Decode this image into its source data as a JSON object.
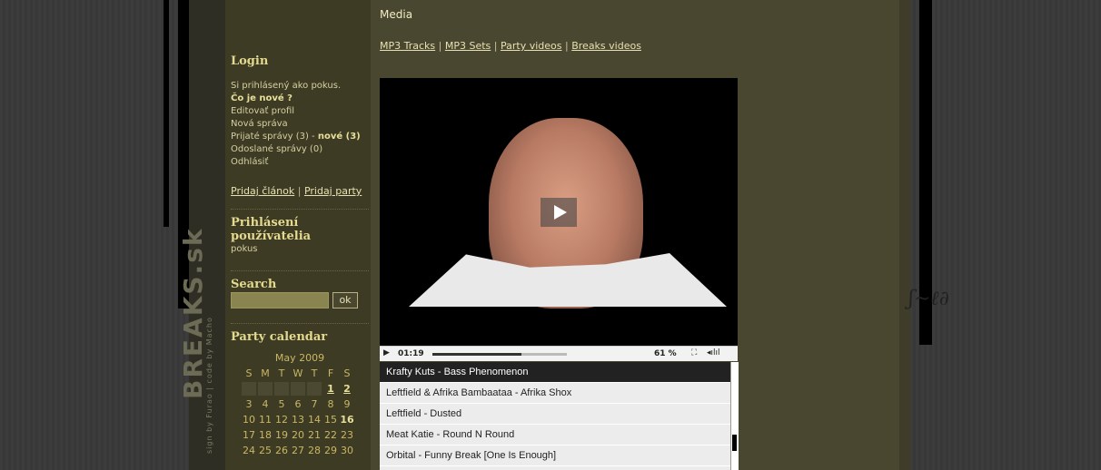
{
  "main": {
    "title": "Media",
    "nav": [
      "MP3 Tracks",
      "MP3 Sets",
      "Party videos",
      "Breaks videos"
    ],
    "nav_sep": "|"
  },
  "sidebar": {
    "login_title": "Login",
    "logged_as": "Si prihlásený ako pokus.",
    "whats_new": "Čo je nové ?",
    "edit_profile": "Editovať profil",
    "new_message": "Nová správa",
    "received": "Prijaté správy (3) -",
    "received_new": "nové (3)",
    "sent": "Odoslané správy (0)",
    "logout": "Odhlásiť",
    "add_article": "Pridaj článok",
    "add_party": "Pridaj party",
    "users_title_1": "Prihlásení",
    "users_title_2": "používatelia",
    "user": "pokus",
    "search_title": "Search",
    "search_button": "ok",
    "calendar_title": "Party calendar"
  },
  "calendar": {
    "month": "May 2009",
    "weekdays": [
      "S",
      "M",
      "T",
      "W",
      "T",
      "F",
      "S"
    ],
    "rows": [
      [
        "",
        "",
        "",
        "",
        "",
        "1",
        "2"
      ],
      [
        "3",
        "4",
        "5",
        "6",
        "7",
        "8",
        "9"
      ],
      [
        "10",
        "11",
        "12",
        "13",
        "14",
        "15",
        "16"
      ],
      [
        "17",
        "18",
        "19",
        "20",
        "21",
        "22",
        "23"
      ],
      [
        "24",
        "25",
        "26",
        "27",
        "28",
        "29",
        "30"
      ]
    ]
  },
  "credit": "sign by Furao | code by Macho",
  "brand": "BREAKS.sk",
  "player": {
    "time": "01:19",
    "progress": 0.66,
    "volume_pct": "61 %"
  },
  "playlist": [
    "Krafty Kuts - Bass Phenomenon",
    "Leftfield & Afrika Bambaataa - Afrika Shox",
    "Leftfield - Dusted",
    "Meat Katie - Round N Round",
    "Orbital - Funny Break [One Is Enough]"
  ]
}
